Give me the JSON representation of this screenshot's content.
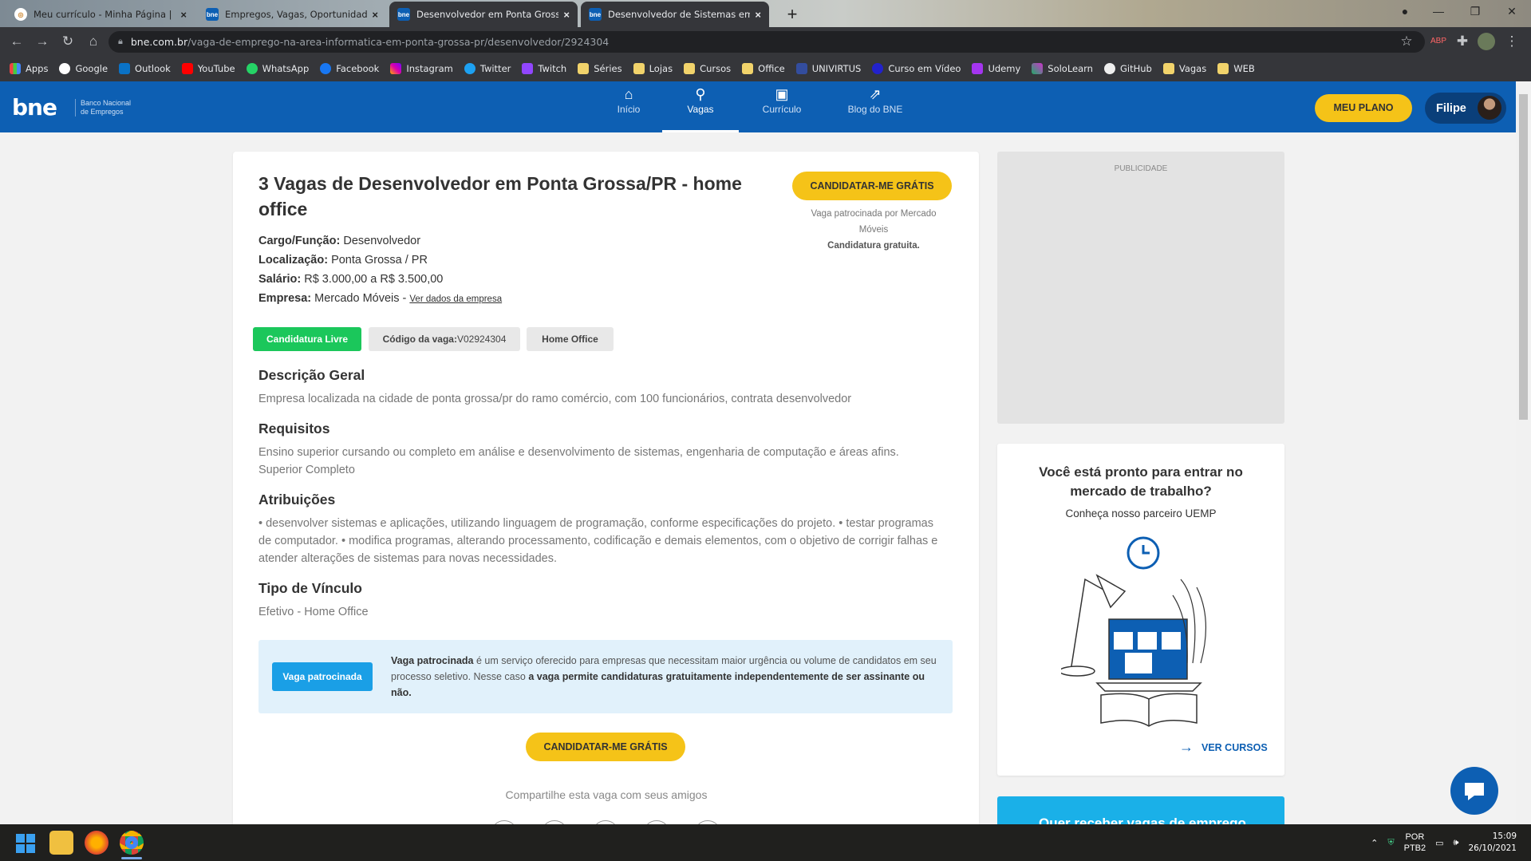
{
  "browser": {
    "tabs": [
      {
        "title": "Meu currículo - Minha Página | E",
        "close": "×",
        "favicon": "bne-icon"
      },
      {
        "title": "Empregos, Vagas, Oportunidades",
        "close": "×",
        "favicon": "bne-icon"
      },
      {
        "title": "Desenvolvedor em Ponta Grossa",
        "close": "×",
        "favicon": "bne-icon"
      },
      {
        "title": "Desenvolvedor de Sistemas em P",
        "close": "×",
        "favicon": "bne-icon"
      }
    ],
    "new_tab": "+",
    "url_host": "bne.com.br",
    "url_path": "/vaga-de-emprego-na-area-informatica-em-ponta-grossa-pr/desenvolvedor/2924304",
    "bookmarks": [
      "Apps",
      "Google",
      "Outlook",
      "YouTube",
      "WhatsApp",
      "Facebook",
      "Instagram",
      "Twitter",
      "Twitch",
      "Séries",
      "Lojas",
      "Cursos",
      "Office",
      "UNIVIRTUS",
      "Curso em Vídeo",
      "Udemy",
      "SoloLearn",
      "GitHub",
      "Vagas",
      "WEB"
    ]
  },
  "header": {
    "logo": "bne",
    "logo_sub_1": "Banco Nacional",
    "logo_sub_2": "de Empregos",
    "nav": [
      {
        "label": "Início",
        "icon": "home-icon"
      },
      {
        "label": "Vagas",
        "icon": "search-icon"
      },
      {
        "label": "Currículo",
        "icon": "resume-icon"
      },
      {
        "label": "Blog do BNE",
        "icon": "external-link-icon"
      }
    ],
    "plan_button": "MEU PLANO",
    "user_name": "Filipe"
  },
  "job": {
    "title": "3 Vagas de Desenvolvedor em Ponta Grossa/PR - home office",
    "cargo_label": "Cargo/Função:",
    "cargo": "Desenvolvedor",
    "local_label": "Localização:",
    "local": "Ponta Grossa / PR",
    "salario_label": "Salário:",
    "salario": "R$ 3.000,00 a R$ 3.500,00",
    "empresa_label": "Empresa:",
    "empresa": "Mercado Móveis - ",
    "empresa_link": "Ver dados da empresa",
    "apply_label": "CANDIDATAR-ME GRÁTIS",
    "sponsor_note": "Vaga patrocinada por Mercado Móveis",
    "sponsor_free": "Candidatura gratuita.",
    "tags": {
      "livre": "Candidatura Livre",
      "codigo_label": "Código da vaga:",
      "codigo": "V02924304",
      "home": "Home Office"
    },
    "sections": {
      "descricao_title": "Descrição Geral",
      "descricao": "Empresa localizada na cidade de ponta grossa/pr do ramo comércio, com 100 funcionários, contrata desenvolvedor",
      "requisitos_title": "Requisitos",
      "requisitos_1": "Ensino superior cursando ou completo em análise e desenvolvimento de sistemas, engenharia de computação e áreas afins.",
      "requisitos_2": "Superior Completo",
      "atribuicoes_title": "Atribuições",
      "atribuicoes": "• desenvolver sistemas e aplicações, utilizando linguagem de programação, conforme especificações do projeto. • testar programas de computador. • modifica programas, alterando processamento, codificação e demais elementos, com o objetivo de corrigir falhas e atender alterações de sistemas para novas necessidades.",
      "vinculo_title": "Tipo de Vínculo",
      "vinculo": "Efetivo - Home Office"
    },
    "sponsored_box": {
      "button": "Vaga patrocinada",
      "text_bold": "Vaga patrocinada",
      "text_1": " é um serviço oferecido para empresas que necessitam maior urgência ou volume de candidatos em seu processo seletivo. Nesse caso ",
      "text_bold_2": "a vaga permite candidaturas gratuitamente independentemente de ser assinante ou não."
    },
    "apply_label_2": "CANDIDATAR-ME GRÁTIS",
    "share_label": "Compartilhe esta vaga com seus amigos"
  },
  "sidebar": {
    "ad_label": "PUBLICIDADE",
    "promo_title": "Você está pronto para entrar no mercado de trabalho?",
    "promo_sub": "Conheça nosso parceiro UEMP",
    "promo_link": "VER CURSOS",
    "banner_text": "Quer receber vagas de emprego"
  },
  "taskbar": {
    "lang_1": "POR",
    "lang_2": "PTB2",
    "time": "15:09",
    "date": "26/10/2021"
  },
  "colors": {
    "brand_blue": "#0d5fb3",
    "accent_yellow": "#f5c318",
    "green_tag": "#1bc75b",
    "sponsor_blue": "#1a9fe6"
  }
}
